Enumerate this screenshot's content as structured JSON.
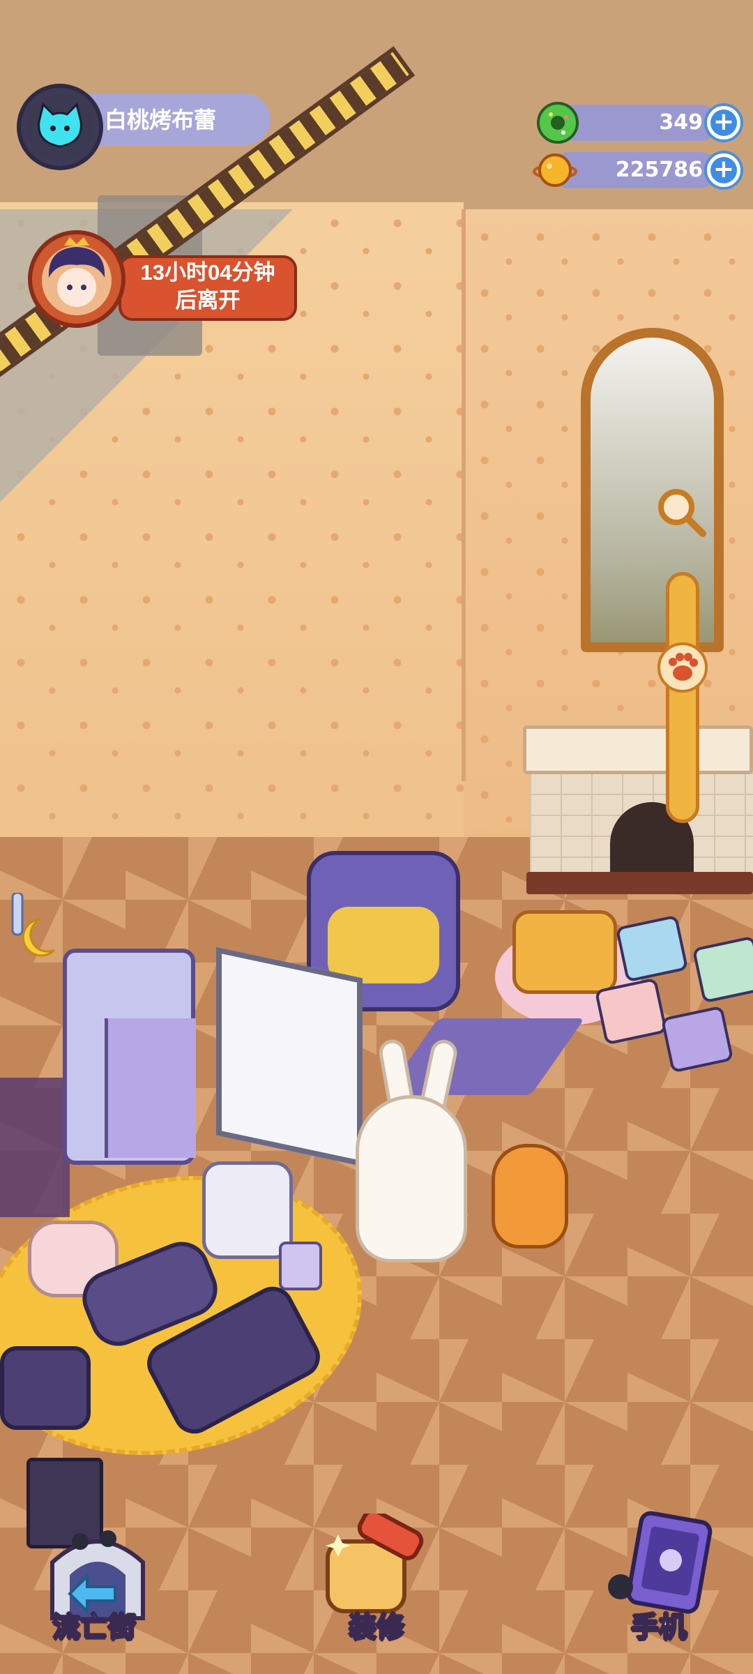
{
  "player": {
    "name": "白桃烤布蕾",
    "avatar_icon": "cat-face-icon"
  },
  "currencies": [
    {
      "icon": "green-donut-icon",
      "value": "349",
      "color": "#3fae3a"
    },
    {
      "icon": "planet-coin-icon",
      "value": "225786",
      "color": "#f2a21e"
    }
  ],
  "visitor": {
    "line1": "13小时04分钟",
    "line2": "后离开",
    "avatar_icon": "visitor-character-icon"
  },
  "bottom_nav": [
    {
      "label": "流亡街",
      "icon": "exile-street-portal-icon"
    },
    {
      "label": "装修",
      "icon": "decorate-brush-icon"
    },
    {
      "label": "手机",
      "icon": "phone-icon"
    }
  ],
  "zoom": {
    "icon": "magnifier-icon",
    "knob_icon": "paw-icon",
    "level": 0.35
  },
  "colors": {
    "accent_blue": "#3f8de3",
    "hud_purple": "#a7a6d9",
    "visitor_red": "#d9532e",
    "wallpaper": "#f4cf9d"
  }
}
